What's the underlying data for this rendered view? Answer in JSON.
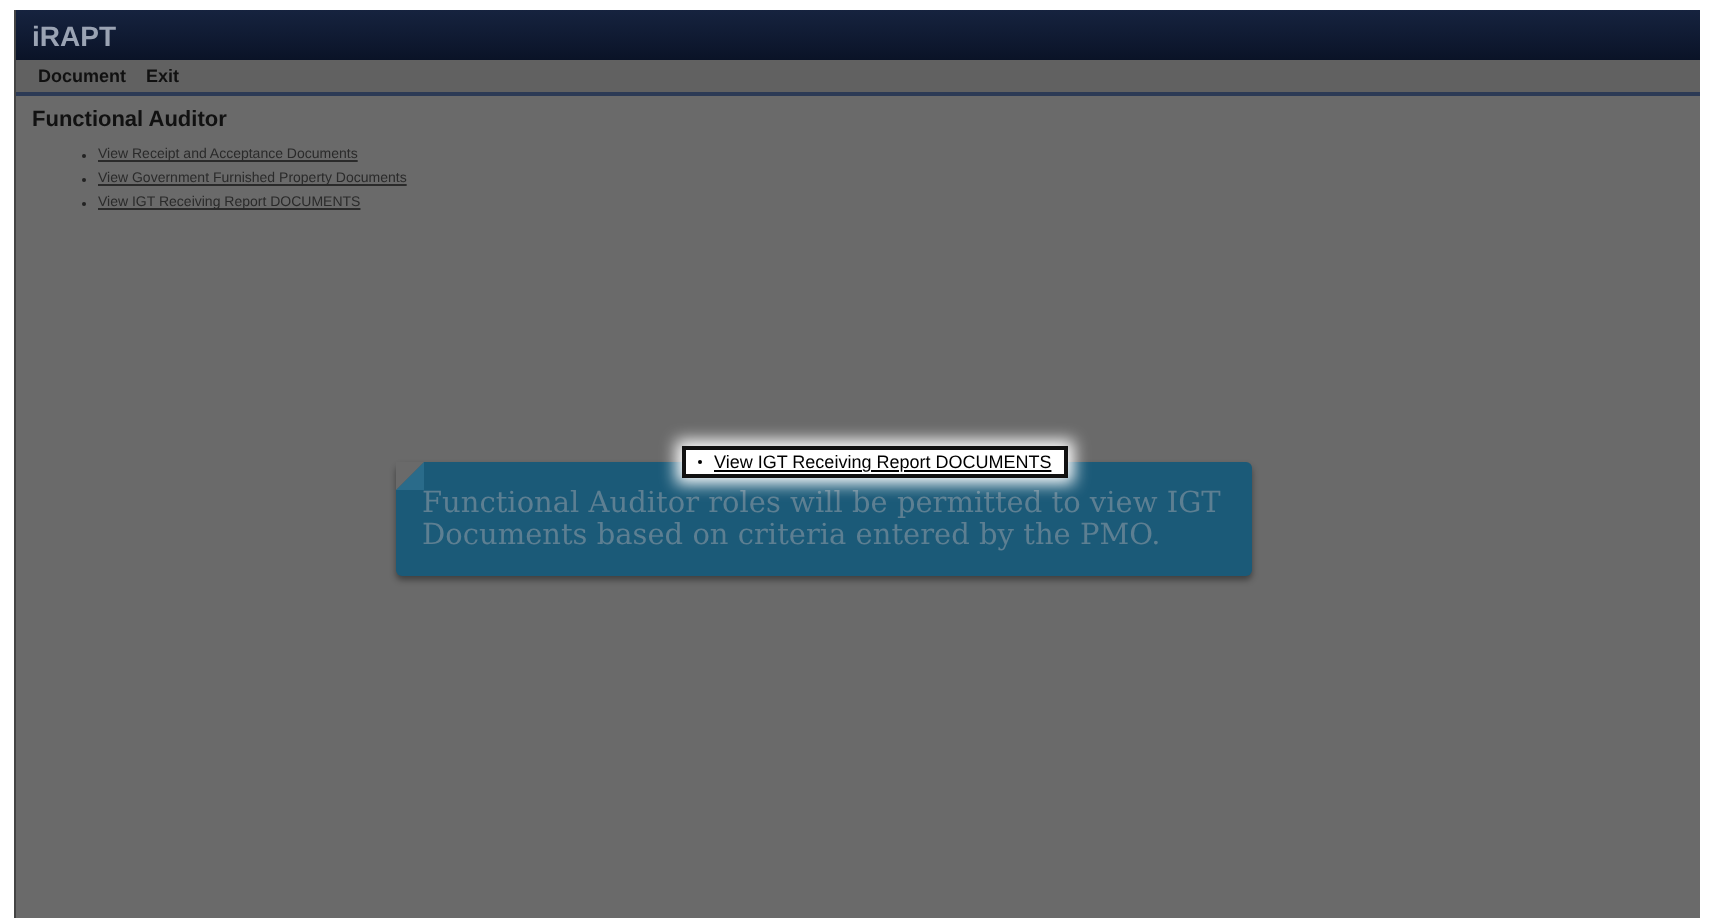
{
  "app": {
    "title": "iRAPT"
  },
  "menu": [
    "Document",
    "Exit"
  ],
  "page_title": "Functional Auditor",
  "links": [
    "View Receipt and Acceptance Documents",
    "View Government Furnished Property Documents",
    "View IGT Receiving Report DOCUMENTS"
  ],
  "highlight": {
    "link": "View IGT Receiving Report DOCUMENTS"
  },
  "callout": {
    "text": "Functional Auditor roles will be permitted to view IGT Documents based on criteria entered by the PMO."
  }
}
